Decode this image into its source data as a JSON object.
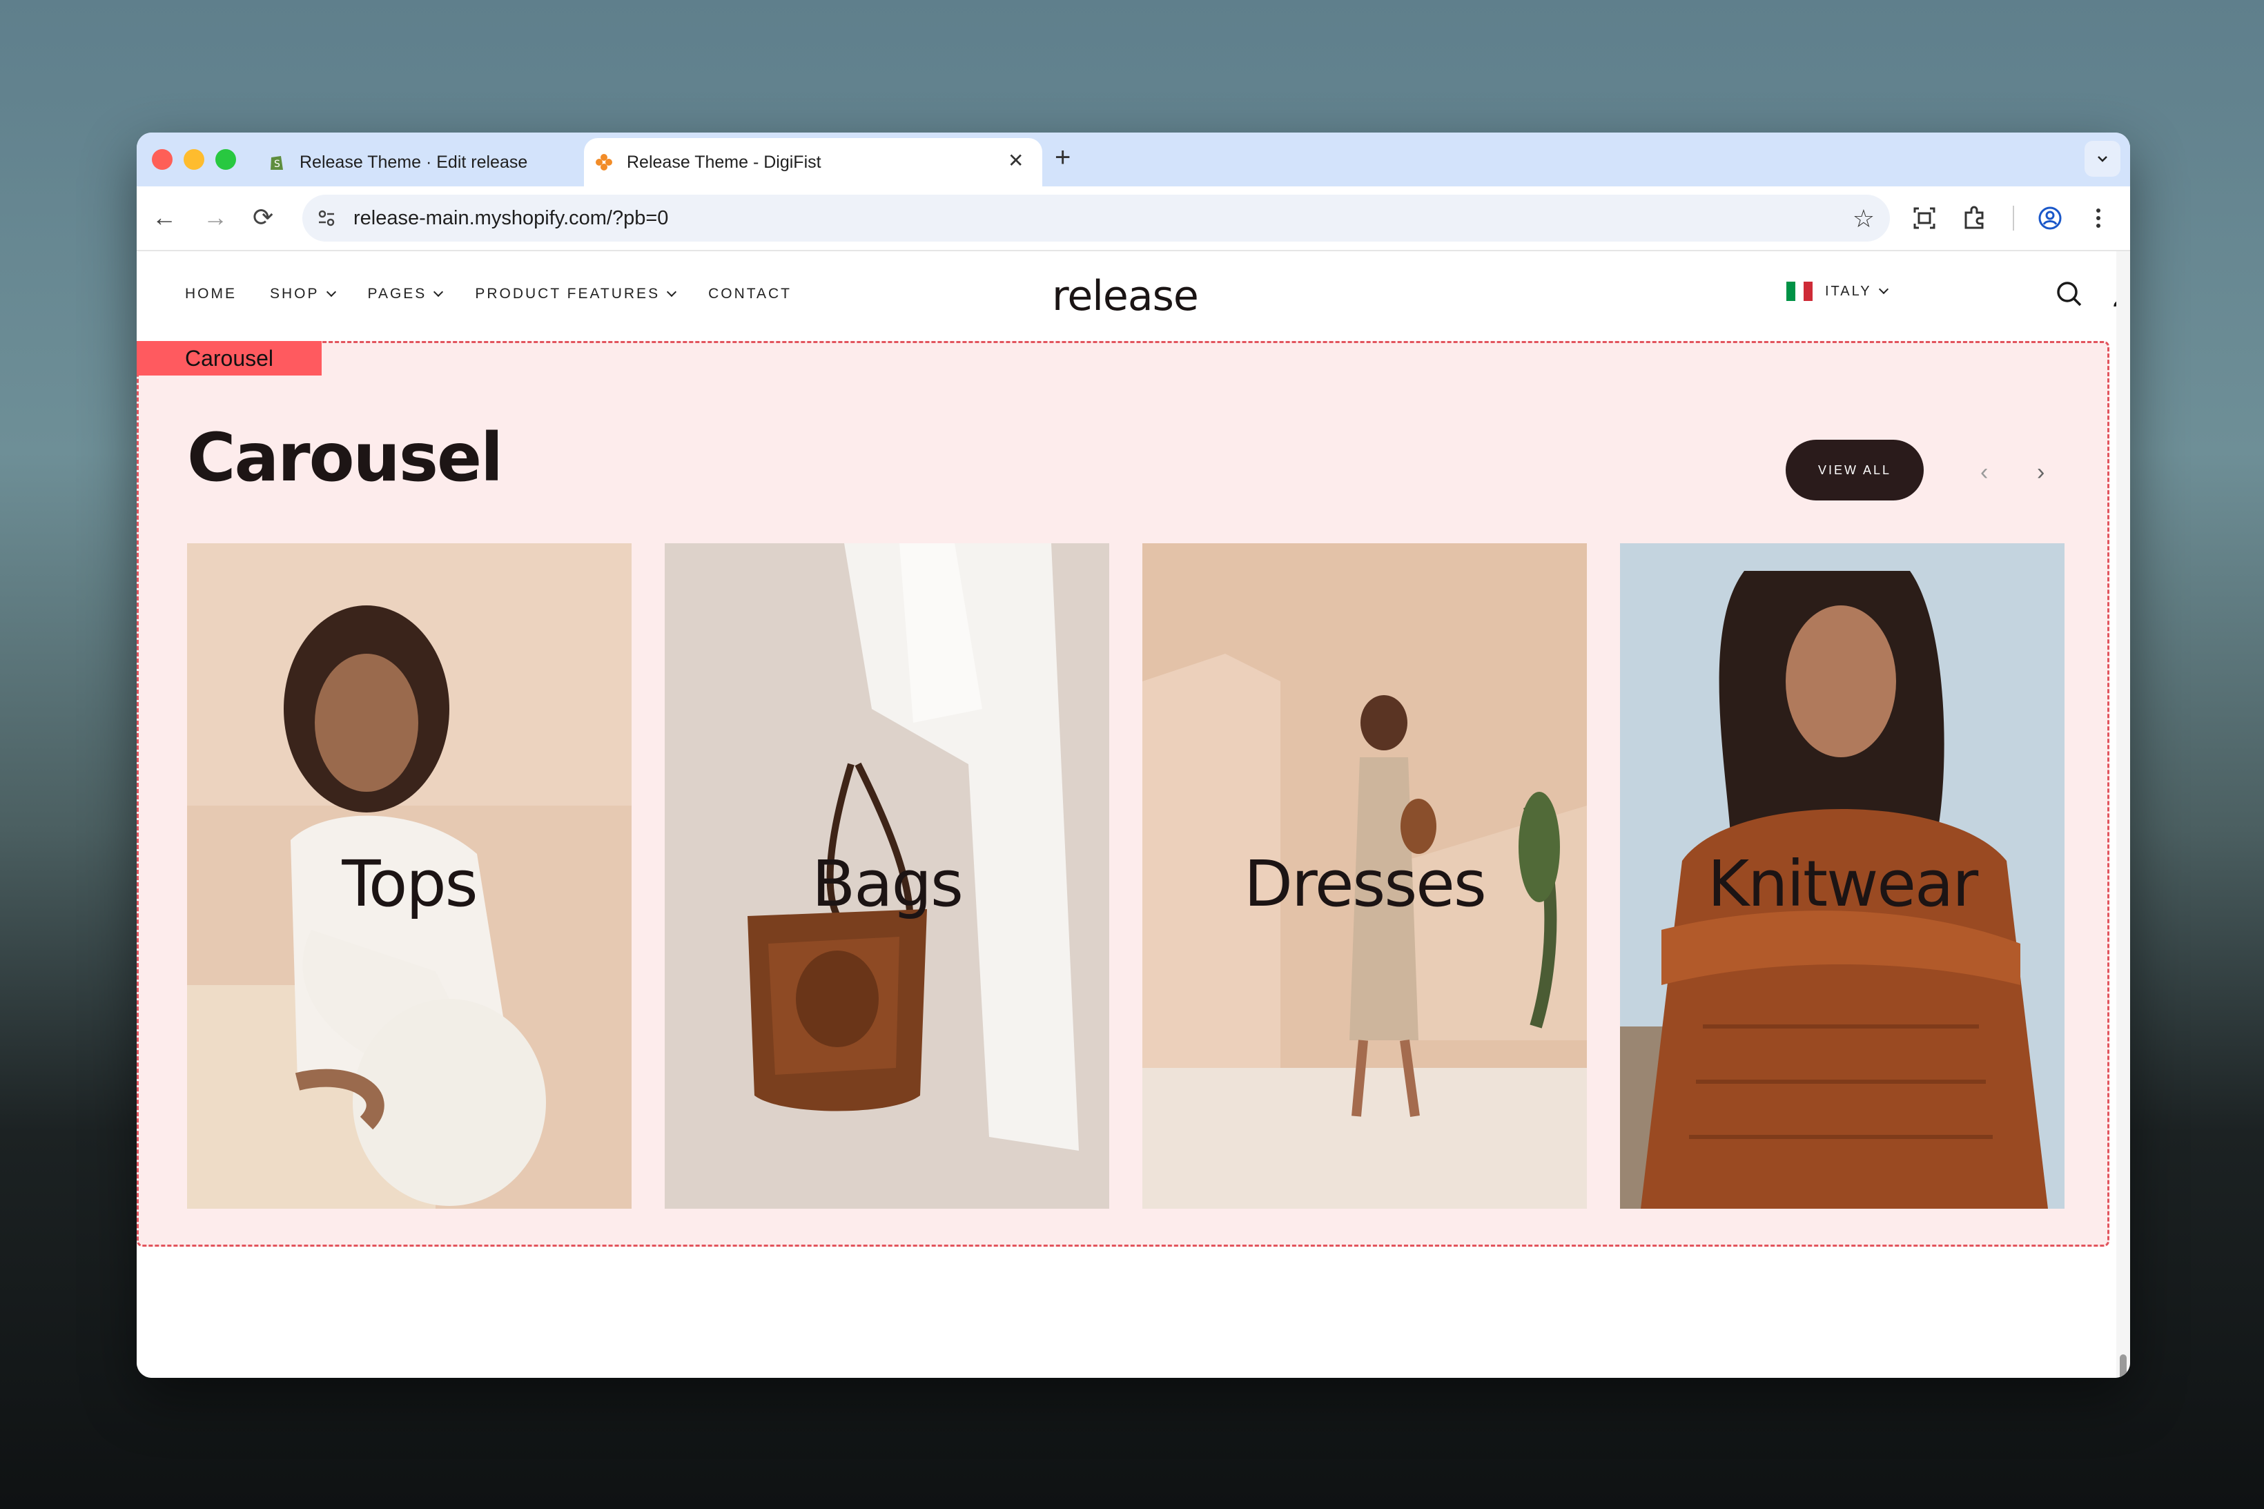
{
  "browser": {
    "tabs": [
      {
        "title": "Release Theme · Edit release",
        "close": "✕"
      },
      {
        "title": "Release Theme - DigiFist",
        "close": "✕"
      }
    ],
    "new_tab": "+",
    "tab_menu": "⌄",
    "url": "release-main.myshopify.com/?pb=0",
    "buttons": {
      "back": "←",
      "forward": "→",
      "reload": "⟳",
      "star": "☆"
    }
  },
  "site": {
    "nav": [
      {
        "label": "HOME",
        "dropdown": false
      },
      {
        "label": "SHOP",
        "dropdown": true
      },
      {
        "label": "PAGES",
        "dropdown": true
      },
      {
        "label": "PRODUCT FEATURES",
        "dropdown": true
      },
      {
        "label": "CONTACT",
        "dropdown": false
      }
    ],
    "logo": "release",
    "locale": {
      "country": "ITALY",
      "flag_colors": [
        "#009246",
        "#ffffff",
        "#ce2b37"
      ]
    }
  },
  "section": {
    "tag": "Carousel",
    "title": "Carousel",
    "view_all": "VIEW ALL",
    "prev": "‹",
    "next": "›",
    "cards": [
      {
        "label": "Tops"
      },
      {
        "label": "Bags"
      },
      {
        "label": "Dresses"
      },
      {
        "label": "Knitwear"
      }
    ]
  },
  "colors": {
    "section_bg": "#fdecec",
    "section_border": "#e2545d",
    "tag_bg": "#ff5a5f",
    "button_dark": "#2a1b1b"
  }
}
